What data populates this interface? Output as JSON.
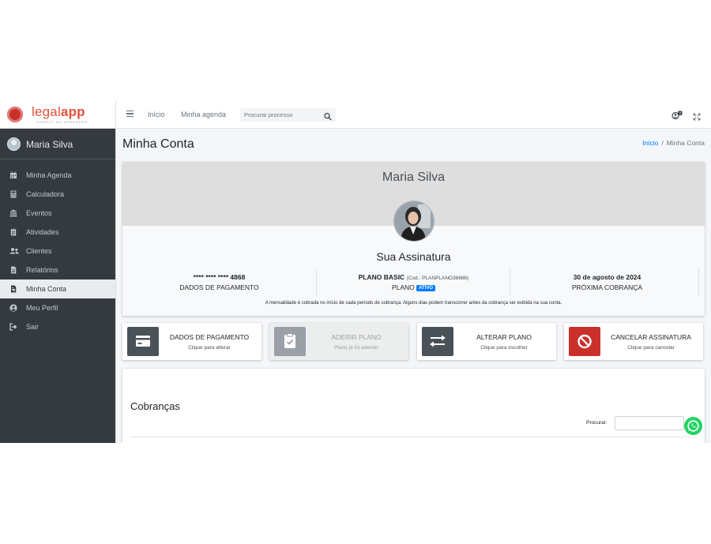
{
  "brand": {
    "name_part1": "legal",
    "name_part2": "app",
    "tagline": "CONECT OU APRENDER"
  },
  "sidebar": {
    "user_name": "Maria Silva",
    "items": [
      {
        "label": "Minha Agenda",
        "icon": "calendar-icon"
      },
      {
        "label": "Calculadora",
        "icon": "calculator-icon"
      },
      {
        "label": "Eventos",
        "icon": "landmark-icon"
      },
      {
        "label": "Atividades",
        "icon": "clipboard-icon"
      },
      {
        "label": "Clientes",
        "icon": "users-icon"
      },
      {
        "label": "Relatórios",
        "icon": "file-icon"
      },
      {
        "label": "Minha Conta",
        "icon": "file-invoice-icon",
        "active": true
      },
      {
        "label": "Meu Perfil",
        "icon": "user-circle-icon"
      },
      {
        "label": "Sair",
        "icon": "sign-out-icon"
      }
    ]
  },
  "topbar": {
    "home_link": "Início",
    "agenda_link": "Minha agenda",
    "search_placeholder": "Procurar processo"
  },
  "page": {
    "title": "Minha Conta",
    "breadcrumb": {
      "home": "Início",
      "separator": "/",
      "current": "Minha Conta"
    }
  },
  "profile": {
    "name": "Maria Silva",
    "subscription_title": "Sua Assinatura",
    "card_number": "**** **** **** 4868",
    "card_label": "DADOS DE PAGAMENTO",
    "plan_name": "PLANO BASIC",
    "plan_code": "(Cod.: PLANPLANO36686)",
    "plan_label": "PLANO",
    "plan_status": "ATIVO",
    "next_charge_date": "30 de agosto de 2024",
    "next_charge_label": "PRÓXIMA COBRANÇA",
    "notice": "A mensalidade é cobrada no início de cada período de cobrança. Alguns dias podem transcorrer antes da cobrança ser exibida na sua conta."
  },
  "actions": [
    {
      "title": "DADOS DE PAGAMENTO",
      "subtitle": "Clique para alterar",
      "icon": "credit-card-icon",
      "color": "#4a5259",
      "disabled": false
    },
    {
      "title": "ADERIR PLANO",
      "subtitle": "Plano já foi aderido",
      "icon": "clipboard-check-icon",
      "color": "#9aa0a6",
      "disabled": true
    },
    {
      "title": "ALTERAR PLANO",
      "subtitle": "Clique para escolher",
      "icon": "exchange-icon",
      "color": "#4a5259",
      "disabled": false
    },
    {
      "title": "CANCELAR ASSINATURA",
      "subtitle": "Clique para cancelar",
      "icon": "ban-icon",
      "color": "#c9302c",
      "disabled": false
    }
  ],
  "charges": {
    "title": "Cobranças",
    "search_label": "Procurar:"
  },
  "colors": {
    "sidebar_bg": "#343a40",
    "accent": "#007bff",
    "danger": "#c9302c",
    "whatsapp": "#25d366"
  }
}
